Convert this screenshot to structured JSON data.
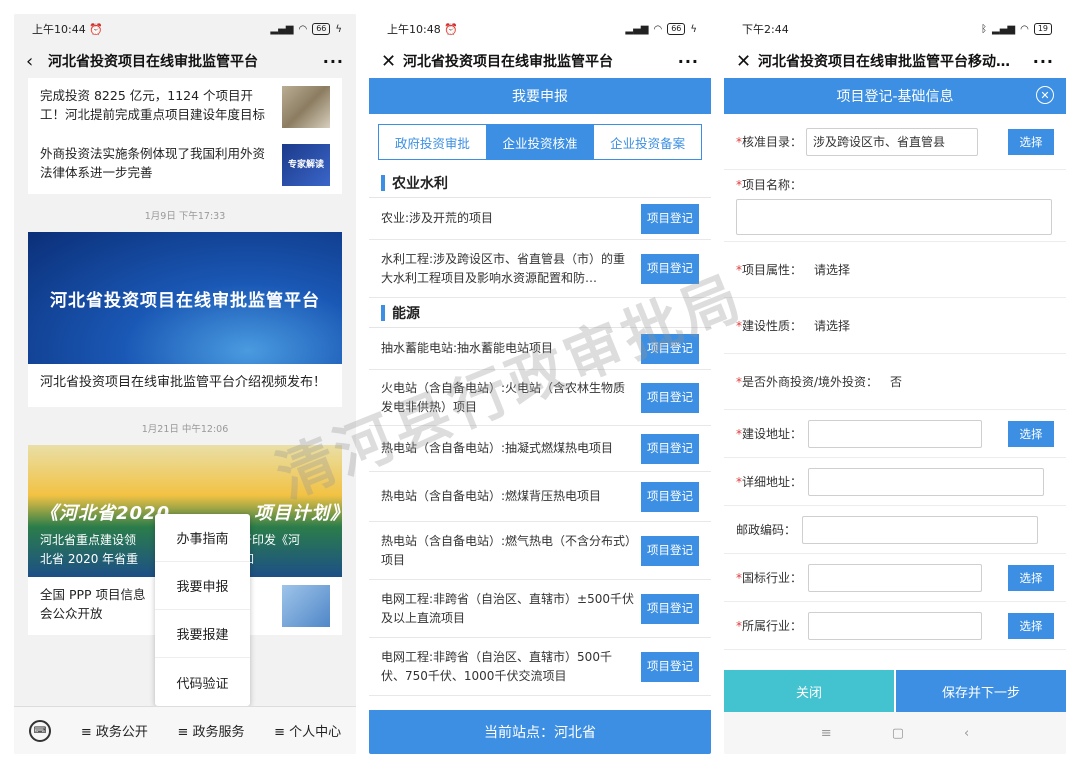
{
  "watermark": "清河县行政审批局",
  "phone1": {
    "status": {
      "time": "上午10:44 ⏰",
      "battery": "66"
    },
    "title": "河北省投资项目在线审批监管平台",
    "news": [
      {
        "text": "完成投资 8225 亿元，1124 个项目开工！河北提前完成重点项目建设年度目标"
      },
      {
        "text": "外商投资法实施条例体现了我国利用外资法律体系进一步完善",
        "thumb": "专家解读"
      }
    ],
    "date1": "1月9日 下午17:33",
    "banner1": "河北省投资项目在线审批监管平台",
    "card1_caption": "河北省投资项目在线审批监管平台介绍视频发布！",
    "date2": "1月21日 中午12:06",
    "banner2_title": "《河北省2020",
    "banner2_title_end": "项目计划》",
    "banner2_sub": "河北省重点建设领",
    "banner2_sub_end": "关于印发《河",
    "banner2_sub2": "北省 2020 年省重",
    "banner2_sub2_end": "通知",
    "news3": "全国 PPP 项目信息",
    "news3_end": "社",
    "news3_line2": "会公众开放",
    "popup": [
      "办事指南",
      "我要申报",
      "我要报建",
      "代码验证"
    ],
    "nav": [
      "≡ 政务公开",
      "≡ 政务服务",
      "≡ 个人中心"
    ]
  },
  "phone2": {
    "status": {
      "time": "上午10:48 ⏰",
      "battery": "66"
    },
    "title": "河北省投资项目在线审批监管平台",
    "header": "我要申报",
    "tabs": [
      "政府投资审批",
      "企业投资核准",
      "企业投资备案"
    ],
    "sections": [
      {
        "name": "农业水利",
        "items": [
          "农业:涉及开荒的项目",
          "水利工程:涉及跨设区市、省直管县（市）的重大水利工程项目及影响水资源配置和防…"
        ]
      },
      {
        "name": "能源",
        "items": [
          "抽水蓄能电站:抽水蓄能电站项目",
          "火电站（含自备电站）:火电站（含农林生物质发电非供热）项目",
          "热电站（含自备电站）:抽凝式燃煤热电项目",
          "热电站（含自备电站）:燃煤背压热电项目",
          "热电站（含自备电站）:燃气热电（不含分布式）项目",
          "电网工程:非跨省（自治区、直辖市）±500千伏及以上直流项目",
          "电网工程:非跨省（自治区、直辖市）500千伏、750千伏、1000千伏交流项目"
        ]
      }
    ],
    "btn": "项目登记",
    "footer": "当前站点：河北省"
  },
  "phone3": {
    "status": {
      "time": "下午2:44",
      "battery": "19"
    },
    "title": "河北省投资项目在线审批监管平台移动…",
    "header": "项目登记-基础信息",
    "fields": {
      "catalog_label": "核准目录：",
      "catalog_value": "涉及跨设区市、省直管县",
      "name_label": "项目名称：",
      "attr_label": "项目属性：",
      "attr_value": "请选择",
      "nature_label": "建设性质：",
      "nature_value": "请选择",
      "foreign_label": "是否外商投资/境外投资：",
      "foreign_value": "否",
      "addr_label": "建设地址：",
      "detail_label": "详细地址：",
      "zip_label": "邮政编码：",
      "industry_label": "国标行业：",
      "belong_label": "所属行业："
    },
    "select": "选择",
    "close": "关闭",
    "save": "保存并下一步"
  }
}
